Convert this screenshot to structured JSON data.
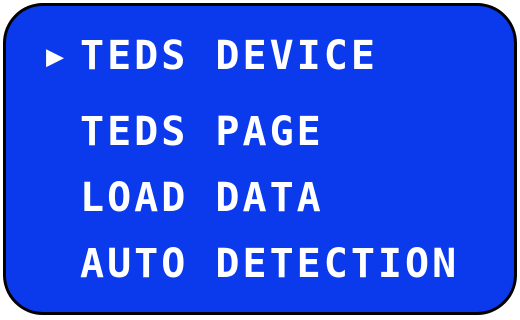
{
  "display": {
    "background_color": "#0a3aec",
    "text_color": "#ffffff",
    "border_color": "#000000"
  },
  "menu": {
    "selected_index": 0,
    "cursor_glyph": "▶",
    "items": [
      {
        "label": "TEDS DEVICE"
      },
      {
        "label": "TEDS PAGE"
      },
      {
        "label": "LOAD DATA"
      },
      {
        "label": "AUTO DETECTION"
      }
    ]
  }
}
